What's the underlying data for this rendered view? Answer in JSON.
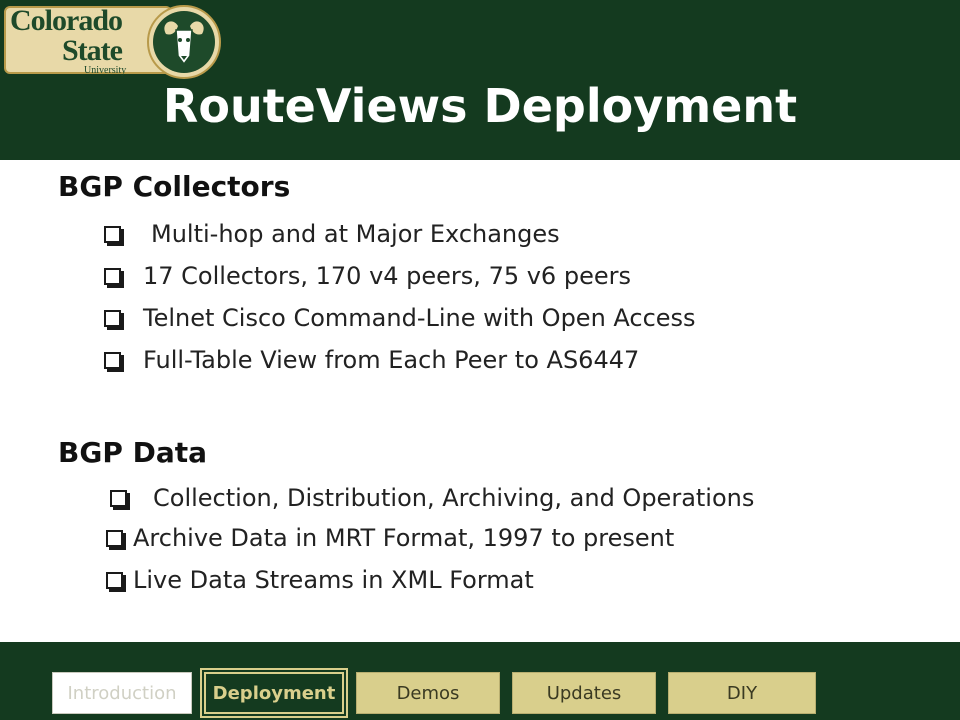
{
  "logo": {
    "line1": "Colorado",
    "line2": "State",
    "line3": "University",
    "seal_icon": "ram-head-icon"
  },
  "title": "RouteViews Deployment",
  "sections": [
    {
      "heading": "BGP Collectors",
      "bullets": [
        "Multi-hop and at Major Exchanges",
        "17 Collectors, 170 v4 peers, 75 v6 peers",
        "Telnet Cisco Command-Line with Open Access",
        "Full-Table View from Each Peer to AS6447"
      ]
    },
    {
      "heading": "BGP Data",
      "bullets": [
        "Collection, Distribution, Archiving, and Operations",
        "Archive Data in MRT Format, 1997 to present",
        "Live Data Streams in XML Format"
      ]
    }
  ],
  "nav": {
    "items": [
      "Introduction",
      "Deployment",
      "Demos",
      "Updates",
      "DIY"
    ],
    "active": "Deployment"
  },
  "colors": {
    "header_green": "#143a1f",
    "nav_tan": "#d9cf8c",
    "logo_gold": "#e8d9a8"
  }
}
